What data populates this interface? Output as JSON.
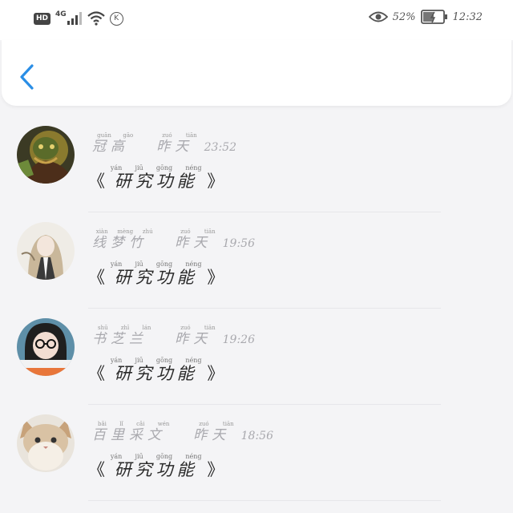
{
  "status_bar": {
    "hd": "HD",
    "network": "4G",
    "battery": "52%",
    "time": "12:32"
  },
  "header": {
    "back_icon": "chevron-left-icon"
  },
  "accent_color": "#2a8ee6",
  "messages": [
    {
      "name": "冠高",
      "name_pinyin": [
        "guān",
        "gāo"
      ],
      "day": "昨天",
      "day_pinyin": [
        "zuó",
        "tiān"
      ],
      "time": "23:52",
      "open_quote": "《",
      "text": "研究功能",
      "text_pinyin": [
        "yán",
        "jiū",
        "gōng",
        "néng"
      ],
      "close_quote": "》"
    },
    {
      "name": "线梦竹",
      "name_pinyin": [
        "xiàn",
        "mèng",
        "zhú"
      ],
      "day": "昨天",
      "day_pinyin": [
        "zuó",
        "tiān"
      ],
      "time": "19:56",
      "open_quote": "《",
      "text": "研究功能",
      "text_pinyin": [
        "yán",
        "jiū",
        "gōng",
        "néng"
      ],
      "close_quote": "》"
    },
    {
      "name": "书芝兰",
      "name_pinyin": [
        "shū",
        "zhī",
        "lán"
      ],
      "day": "昨天",
      "day_pinyin": [
        "zuó",
        "tiān"
      ],
      "time": "19:26",
      "open_quote": "《",
      "text": "研究功能",
      "text_pinyin": [
        "yán",
        "jiū",
        "gōng",
        "néng"
      ],
      "close_quote": "》"
    },
    {
      "name": "百里采文",
      "name_pinyin": [
        "bǎi",
        "lǐ",
        "cǎi",
        "wén"
      ],
      "day": "昨天",
      "day_pinyin": [
        "zuó",
        "tiān"
      ],
      "time": "18:56",
      "open_quote": "《",
      "text": "研究功能",
      "text_pinyin": [
        "yán",
        "jiū",
        "gōng",
        "néng"
      ],
      "close_quote": "》"
    }
  ]
}
